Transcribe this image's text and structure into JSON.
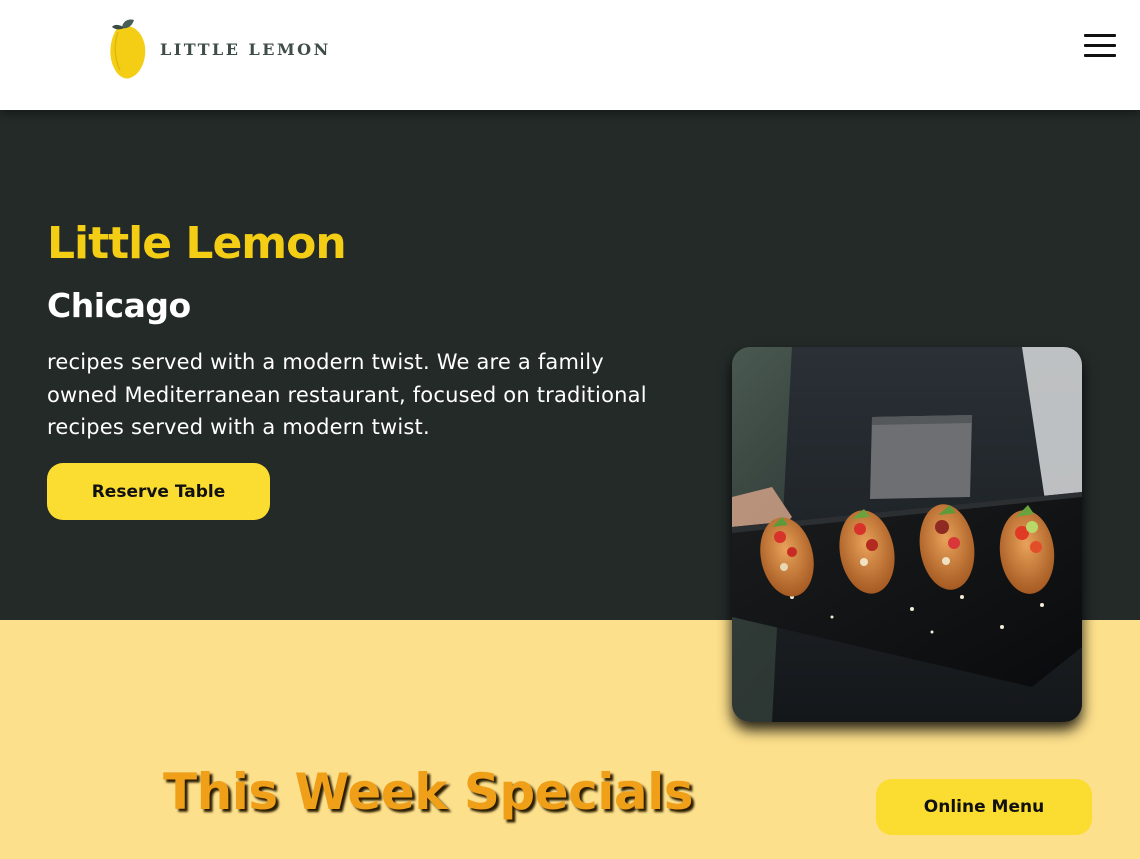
{
  "header": {
    "logo_text": "LITTLE LEMON",
    "menu_icon": "hamburger-menu-icon"
  },
  "hero": {
    "title": "Little Lemon",
    "subtitle": "Chicago",
    "description": "recipes served with a modern twist. We are a family owned Mediterranean restaurant, focused on traditional recipes served with a modern twist.",
    "reserve_label": "Reserve Table",
    "image_name": "bruschetta-platter-photo"
  },
  "specials": {
    "title": "This Week Specials",
    "online_menu_label": "Online Menu"
  },
  "colors": {
    "primary_dark": "#232a28",
    "primary_yellow": "#f4ce14",
    "button_yellow": "#fbdc30",
    "specials_bg": "#fde08c",
    "specials_title": "#ef9f18"
  }
}
